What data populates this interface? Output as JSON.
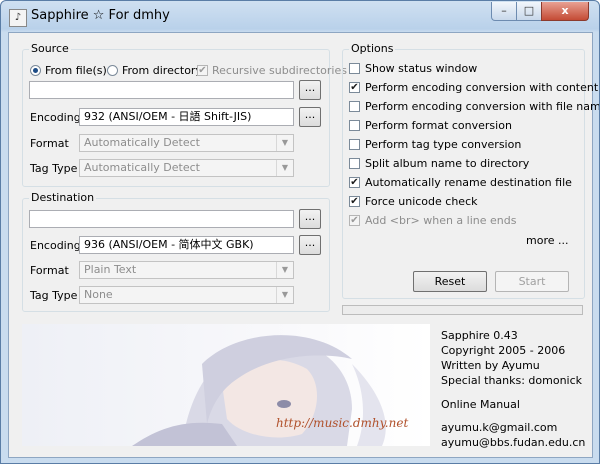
{
  "window": {
    "title": "Sapphire ☆ For dmhy",
    "icon": "app-icon",
    "controls": {
      "minimize": "–",
      "maximize": "□",
      "close": "x"
    }
  },
  "source": {
    "legend": "Source",
    "from_files_label": "From file(s)",
    "from_files_selected": true,
    "from_directory_label": "From directory",
    "recursive_label": "Recursive subdirectories",
    "recursive_checked": true,
    "path_value": "",
    "browse_label": "...",
    "encoding_label": "Encoding",
    "encoding_value": "932  (ANSI/OEM - 日語 Shift-JIS)",
    "encoding_browse_label": "...",
    "format_label": "Format",
    "format_value": "Automatically Detect",
    "tagtype_label": "Tag Type",
    "tagtype_value": "Automatically Detect"
  },
  "destination": {
    "legend": "Destination",
    "path_value": "",
    "browse_label": "...",
    "encoding_label": "Encoding",
    "encoding_value": "936  (ANSI/OEM - 简体中文 GBK)",
    "encoding_browse_label": "...",
    "format_label": "Format",
    "format_value": "Plain Text",
    "tagtype_label": "Tag Type",
    "tagtype_value": "None"
  },
  "options": {
    "legend": "Options",
    "items": [
      {
        "label": "Show status window",
        "checked": false
      },
      {
        "label": "Perform encoding conversion with content",
        "checked": true
      },
      {
        "label": "Perform encoding conversion with file name",
        "checked": false
      },
      {
        "label": "Perform format conversion",
        "checked": false
      },
      {
        "label": "Perform tag type conversion",
        "checked": false
      },
      {
        "label": "Split album name to directory",
        "checked": false
      },
      {
        "label": "Automatically rename destination file",
        "checked": true
      },
      {
        "label": "Force unicode check",
        "checked": true
      },
      {
        "label": "Add <br> when a line ends",
        "checked": true
      }
    ],
    "more_label": "more ...",
    "reset_label": "Reset",
    "start_label": "Start"
  },
  "about": {
    "version": "Sapphire 0.43",
    "copyright": "Copyright 2005 - 2006",
    "written_by": "Written by Ayumu",
    "thanks": "Special thanks: domonick",
    "manual_link": "Online Manual",
    "email1": "ayumu.k@gmail.com",
    "email2": "ayumu@bbs.fudan.edu.cn",
    "banner_url": "http://music.dmhy.net"
  },
  "glyphs": {
    "check": "✔",
    "arrow": "▼"
  }
}
